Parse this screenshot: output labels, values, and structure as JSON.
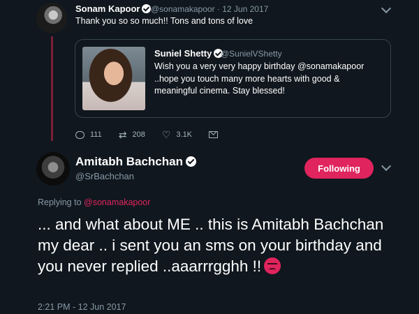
{
  "reply_tweet": {
    "author_name": "Sonam Kapoor",
    "handle_date": "@sonamakapoor · 12 Jun 2017",
    "text": "Thank you so so much!! Tons and tons of love",
    "quoted": {
      "author_name": "Suniel Shetty",
      "handle": "@SunielVShetty",
      "text": "Wish you a very very happy birthday @sonamakapoor ..hope you touch many more hearts with good & meaningful cinema. Stay blessed!"
    },
    "actions": {
      "replies": "111",
      "retweets": "208",
      "likes": "3.1K"
    }
  },
  "main_tweet": {
    "author_name": "Amitabh Bachchan",
    "handle": "@SrBachchan",
    "follow_label": "Following",
    "replying_prefix": "Replying to",
    "replying_to": "@sonamakapoor",
    "text": "... and what about ME .. this is Amitabh Bachchan my dear .. i sent you an sms on your birthday and you never replied ..aaarrrgghh !!",
    "emoji": "angry-face-emoji",
    "timestamp": "2:21 PM - 12 Jun 2017"
  },
  "colors": {
    "background": "#10171e",
    "accent": "#e0245e",
    "muted": "#8899a6",
    "border": "#38444d"
  }
}
